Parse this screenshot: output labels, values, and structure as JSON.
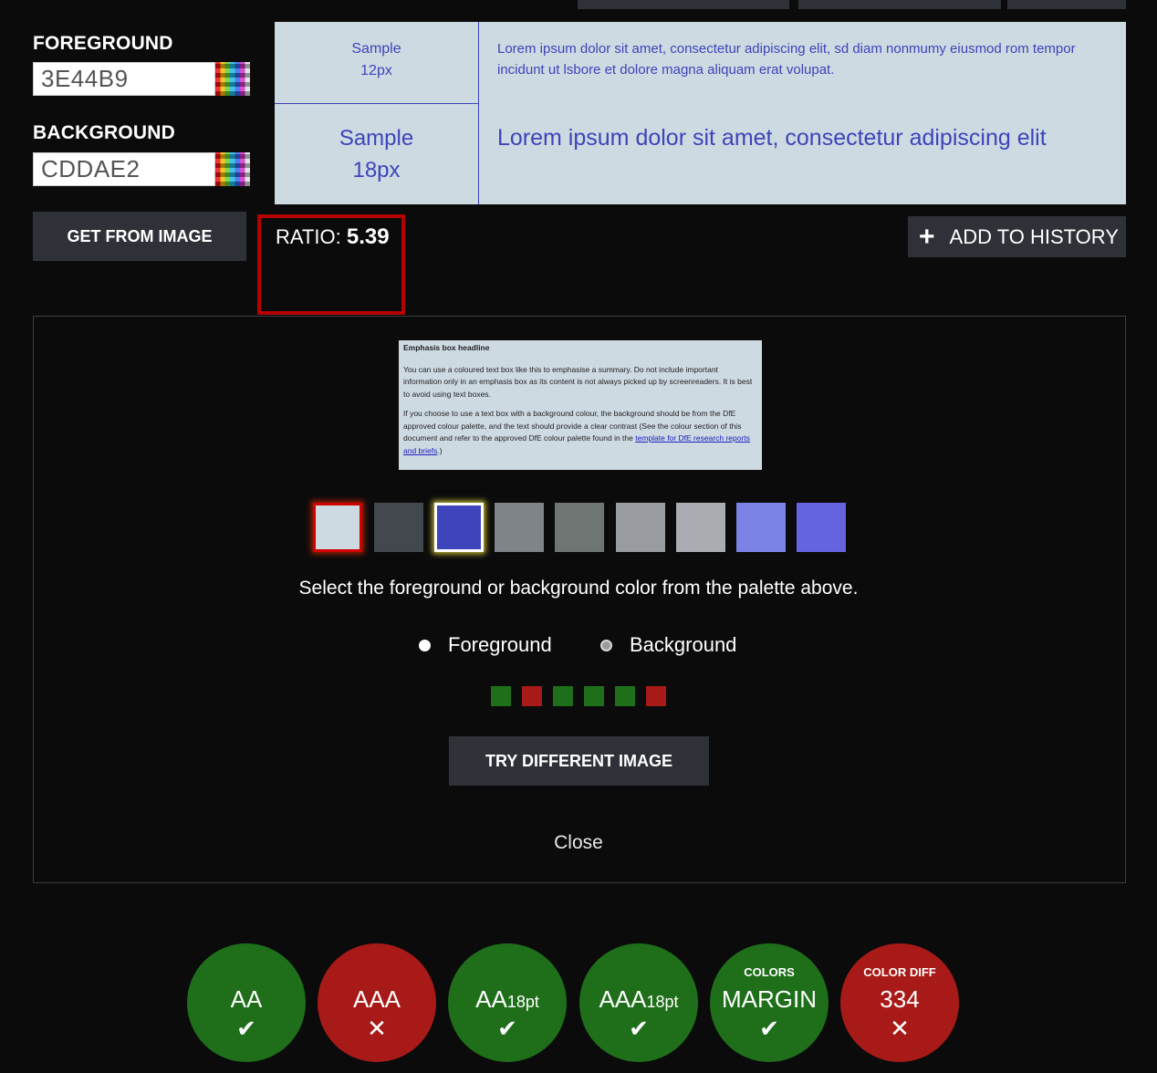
{
  "colors": {
    "foreground_hex": "#3e44b9",
    "background_hex": "#cddae2",
    "pass_green": "#1e6e1a",
    "fail_red": "#a81a17",
    "button_dark": "#2e3238",
    "highlight_red": "#b40000"
  },
  "foreground": {
    "label": "FOREGROUND",
    "value": "3E44B9",
    "picker_icon": "color-palette-icon"
  },
  "background": {
    "label": "BACKGROUND",
    "value": "CDDAE2",
    "picker_icon": "color-palette-icon"
  },
  "preview": {
    "sample_small": "Sample\n12px",
    "sample_large": "Sample\n18px",
    "lorem_small": "Lorem ipsum dolor sit amet, consectetur adipiscing elit, sd diam nonmumy eiusmod rom tempor incidunt ut lsbore et dolore magna aliquam erat volupat.",
    "lorem_large": "Lorem ipsum dolor sit amet, consectetur adipiscing elit"
  },
  "buttons": {
    "get_from_image": "GET FROM IMAGE",
    "add_to_history": "ADD TO HISTORY",
    "add_icon": "plus-icon",
    "try_different_image": "TRY DIFFERENT IMAGE",
    "close": "Close"
  },
  "ratio": {
    "label": "RATIO:",
    "value": "5.39"
  },
  "image_preview": {
    "headline": "Emphasis box headline",
    "para1": "You can use a coloured text box like this to emphasise a summary. Do not include important information only in an emphasis box as its content is not always picked up by screenreaders. It is best to avoid using text boxes.",
    "para2": "If you choose to use a text box with a background colour, the background should be from the DfE approved colour palette, and the text should provide a clear contrast (See the colour section of this document and refer to the approved DfE colour palette found in the",
    "link": "template for DfE research reports and briefs",
    "para2_end": ".)"
  },
  "palette": {
    "swatches": [
      {
        "color": "#cddae2",
        "state": "background"
      },
      {
        "color": "#43484e",
        "state": "none"
      },
      {
        "color": "#3e44b9",
        "state": "foreground"
      },
      {
        "color": "#7f8489",
        "state": "none"
      },
      {
        "color": "#6f7572",
        "state": "none"
      },
      {
        "color": "#989ca1",
        "state": "none"
      },
      {
        "color": "#a9adb1",
        "state": "none"
      },
      {
        "color": "#7b84e6",
        "state": "none"
      },
      {
        "color": "#6563e0",
        "state": "none"
      }
    ],
    "instructions": "Select the foreground or background color from the palette above."
  },
  "radio": {
    "foreground_label": "Foreground",
    "background_label": "Background",
    "selected": "foreground"
  },
  "status_squares": [
    "pass",
    "fail",
    "pass",
    "pass",
    "pass",
    "fail"
  ],
  "badges": [
    {
      "top": "",
      "main": "AA",
      "sub": "",
      "result": "pass",
      "mark": "✔"
    },
    {
      "top": "",
      "main": "AAA",
      "sub": "",
      "result": "fail",
      "mark": "✕"
    },
    {
      "top": "",
      "main": "AA",
      "sub": "18pt",
      "result": "pass",
      "mark": "✔"
    },
    {
      "top": "",
      "main": "AAA",
      "sub": "18pt",
      "result": "pass",
      "mark": "✔"
    },
    {
      "top": "COLORS",
      "main": "MARGIN",
      "sub": "",
      "result": "pass",
      "mark": "✔"
    },
    {
      "top": "COLOR DIFF",
      "main": "334",
      "sub": "",
      "result": "fail",
      "mark": "✕"
    }
  ]
}
